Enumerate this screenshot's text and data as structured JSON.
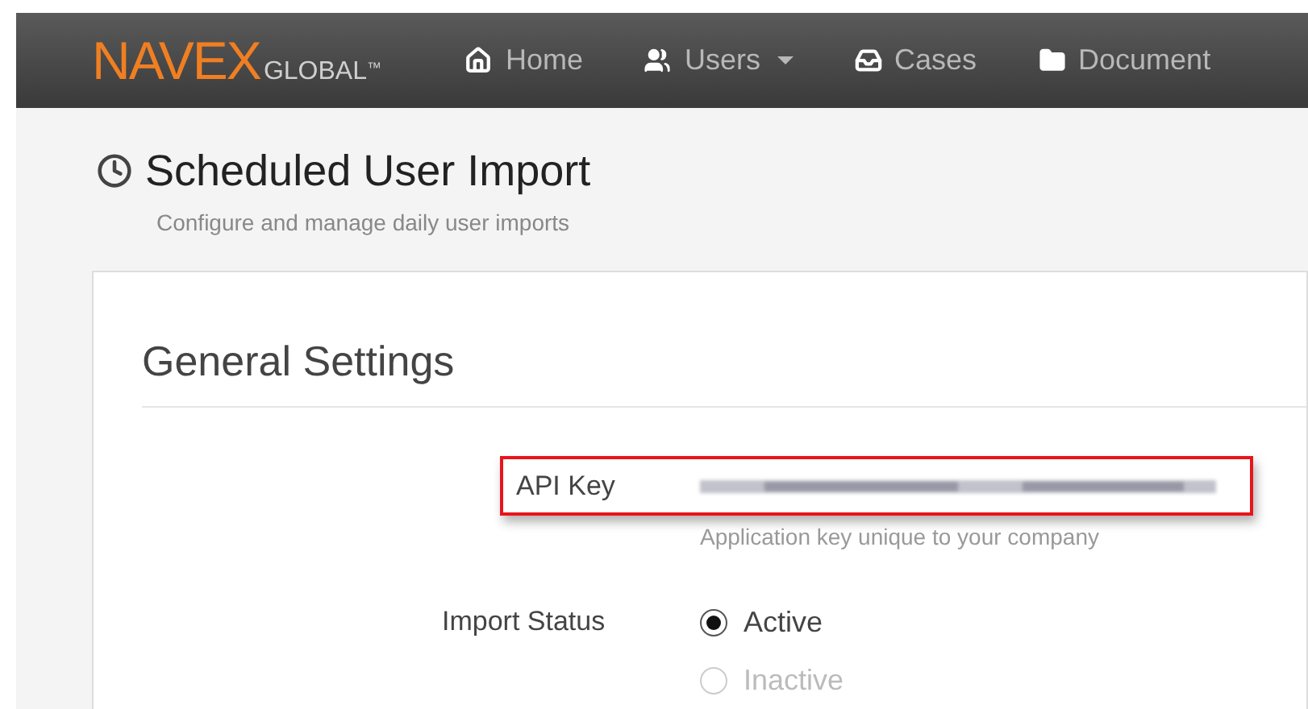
{
  "logo": {
    "main": "NAVEX",
    "sub": "GLOBAL",
    "mark": "™"
  },
  "nav": [
    {
      "label": "Home",
      "kind": "home"
    },
    {
      "label": "Users",
      "kind": "users",
      "dropdown": true
    },
    {
      "label": "Cases",
      "kind": "tray"
    },
    {
      "label": "Document",
      "kind": "folder"
    }
  ],
  "page": {
    "title": "Scheduled User Import",
    "subtitle": "Configure and manage daily user imports"
  },
  "section": {
    "title": "General Settings"
  },
  "api_key": {
    "label": "API Key",
    "help": "Application key unique to your company",
    "highlighted": true
  },
  "import_status": {
    "label": "Import Status",
    "options": [
      {
        "label": "Active",
        "selected": true,
        "disabled": false
      },
      {
        "label": "Inactive",
        "selected": false,
        "disabled": true
      }
    ]
  }
}
